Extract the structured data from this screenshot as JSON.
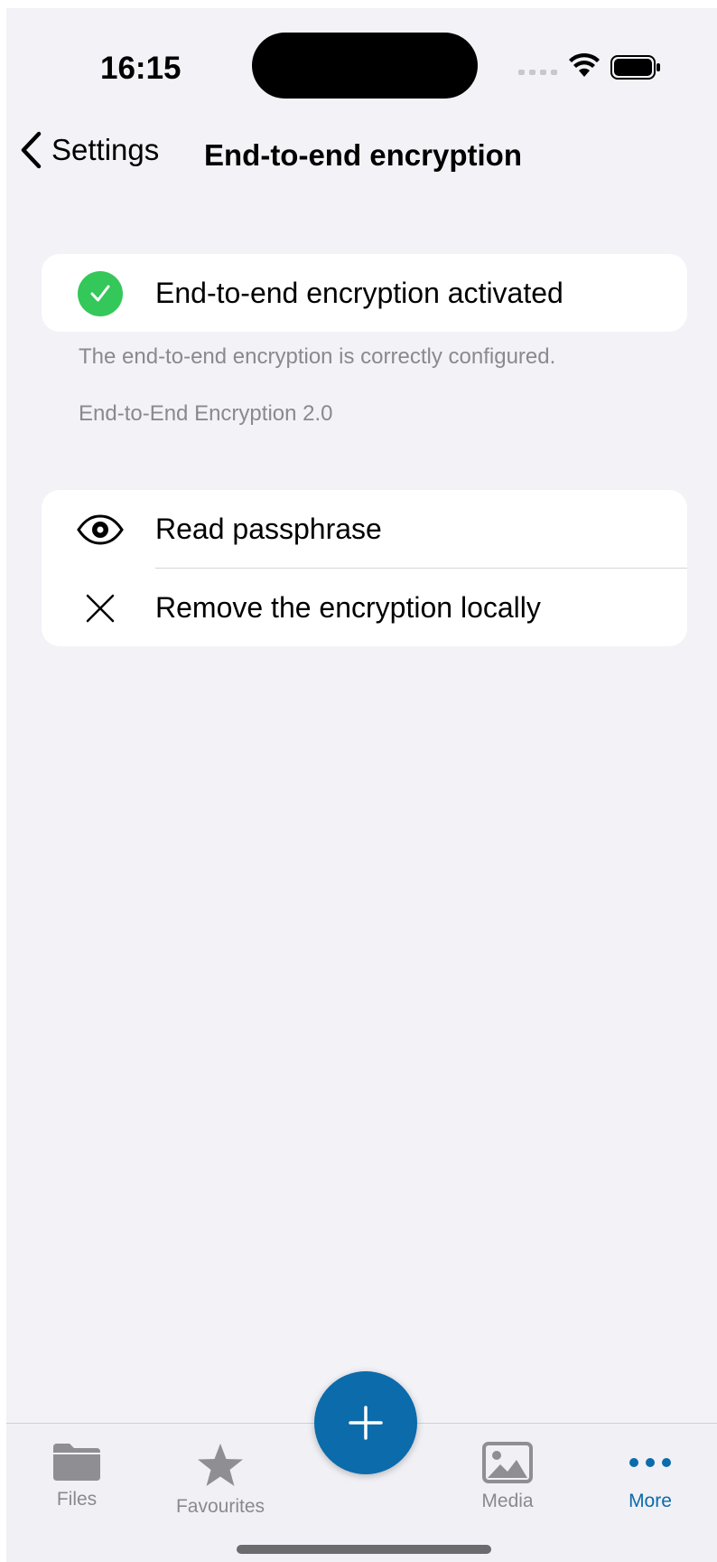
{
  "status_bar": {
    "time": "16:15"
  },
  "nav": {
    "back_label": "Settings",
    "title": "End-to-end encryption"
  },
  "status_card": {
    "label": "End-to-end encryption activated",
    "icon": "checkmark-circle-icon",
    "icon_color": "#34c759"
  },
  "footnotes": {
    "configured": "The end-to-end encryption is correctly configured.",
    "version": "End-to-End Encryption 2.0"
  },
  "actions": [
    {
      "label": "Read passphrase",
      "icon": "eye-icon"
    },
    {
      "label": "Remove the encryption locally",
      "icon": "close-icon"
    }
  ],
  "tabbar": {
    "items": [
      {
        "label": "Files",
        "icon": "folder-icon",
        "active": false
      },
      {
        "label": "Favourites",
        "icon": "star-icon",
        "active": false
      },
      {
        "label": "Media",
        "icon": "image-icon",
        "active": false
      },
      {
        "label": "More",
        "icon": "more-dots-icon",
        "active": true
      }
    ],
    "fab_icon": "plus-icon"
  },
  "colors": {
    "accent": "#0b6bab",
    "background": "#f2f2f7",
    "success": "#34c759",
    "secondary_text": "#8a8a8e"
  }
}
